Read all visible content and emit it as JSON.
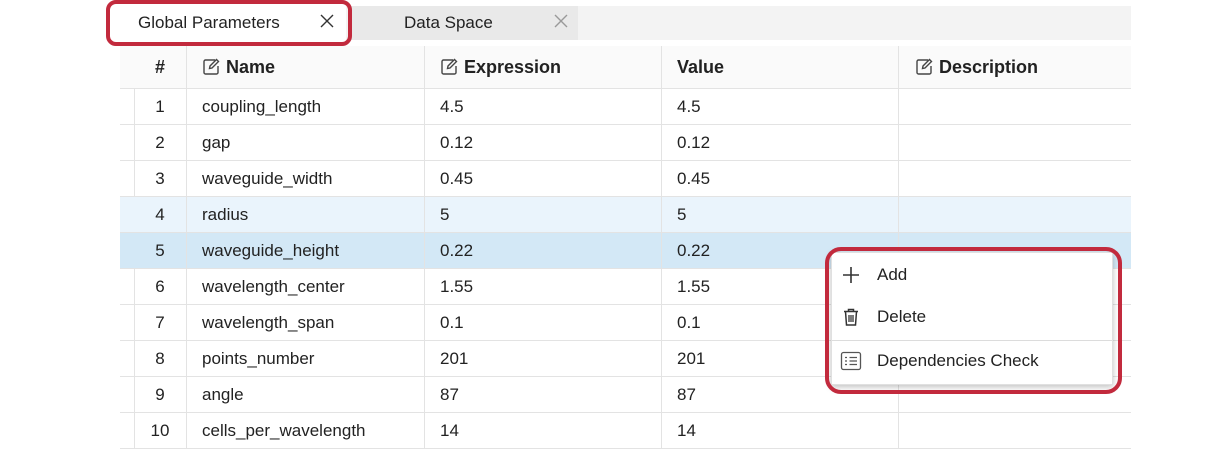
{
  "tabs": [
    {
      "label": "Global Parameters",
      "active": true
    },
    {
      "label": "Data Space",
      "active": false
    }
  ],
  "table": {
    "columns": [
      "#",
      "Name",
      "Expression",
      "Value",
      "Description"
    ],
    "rows": [
      {
        "num": "1",
        "name": "coupling_length",
        "expression": "4.5",
        "value": "4.5",
        "description": ""
      },
      {
        "num": "2",
        "name": "gap",
        "expression": "0.12",
        "value": "0.12",
        "description": ""
      },
      {
        "num": "3",
        "name": "waveguide_width",
        "expression": "0.45",
        "value": "0.45",
        "description": ""
      },
      {
        "num": "4",
        "name": "radius",
        "expression": "5",
        "value": "5",
        "description": ""
      },
      {
        "num": "5",
        "name": "waveguide_height",
        "expression": "0.22",
        "value": "0.22",
        "description": ""
      },
      {
        "num": "6",
        "name": "wavelength_center",
        "expression": "1.55",
        "value": "1.55",
        "description": ""
      },
      {
        "num": "7",
        "name": "wavelength_span",
        "expression": "0.1",
        "value": "0.1",
        "description": ""
      },
      {
        "num": "8",
        "name": "points_number",
        "expression": "201",
        "value": "201",
        "description": ""
      },
      {
        "num": "9",
        "name": "angle",
        "expression": "87",
        "value": "87",
        "description": ""
      },
      {
        "num": "10",
        "name": "cells_per_wavelength",
        "expression": "14",
        "value": "14",
        "description": ""
      }
    ]
  },
  "context_menu": {
    "items": [
      {
        "label": "Add",
        "icon": "plus-icon"
      },
      {
        "label": "Delete",
        "icon": "trash-icon"
      },
      {
        "label": "Dependencies Check",
        "icon": "checklist-icon"
      }
    ]
  },
  "colors": {
    "highlight": "#c22a3d",
    "row_selected": "#d3e8f6",
    "row_hover": "#eaf4fc"
  }
}
